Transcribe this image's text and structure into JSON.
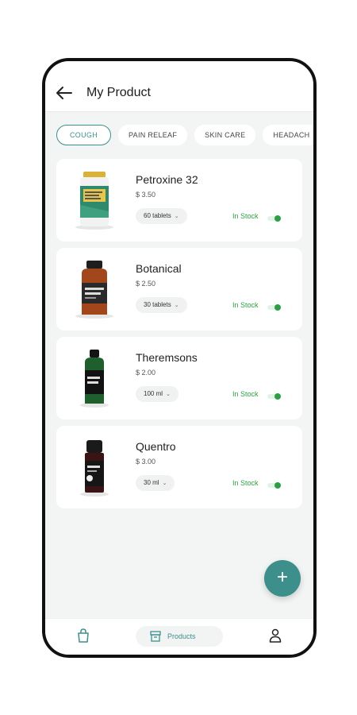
{
  "header": {
    "title": "My Product",
    "back_icon": "arrow-left-icon"
  },
  "categories": [
    {
      "label": "COUGH",
      "active": true
    },
    {
      "label": "PAIN RELEAF",
      "active": false
    },
    {
      "label": "SKIN CARE",
      "active": false
    },
    {
      "label": "HEADACH",
      "active": false
    }
  ],
  "products": [
    {
      "name": "Petroxine 32",
      "price": "$ 3.50",
      "quantity": "60 tablets",
      "stock": "In Stock",
      "in_stock": true
    },
    {
      "name": "Botanical",
      "price": "$ 2.50",
      "quantity": "30 tablets",
      "stock": "In Stock",
      "in_stock": true
    },
    {
      "name": "Theremsons",
      "price": "$ 2.00",
      "quantity": "100 ml",
      "stock": "In Stock",
      "in_stock": true
    },
    {
      "name": "Quentro",
      "price": "$ 3.00",
      "quantity": "30 ml",
      "stock": "In Stock",
      "in_stock": true
    }
  ],
  "fab": {
    "label": "+",
    "icon": "plus-icon"
  },
  "nav": {
    "left_icon": "shopping-bag-icon",
    "center_label": "Products",
    "center_icon": "archive-box-icon",
    "right_icon": "user-icon"
  },
  "colors": {
    "accent": "#3d8f8c",
    "stock_green": "#2ea043",
    "background": "#f3f5f5"
  }
}
